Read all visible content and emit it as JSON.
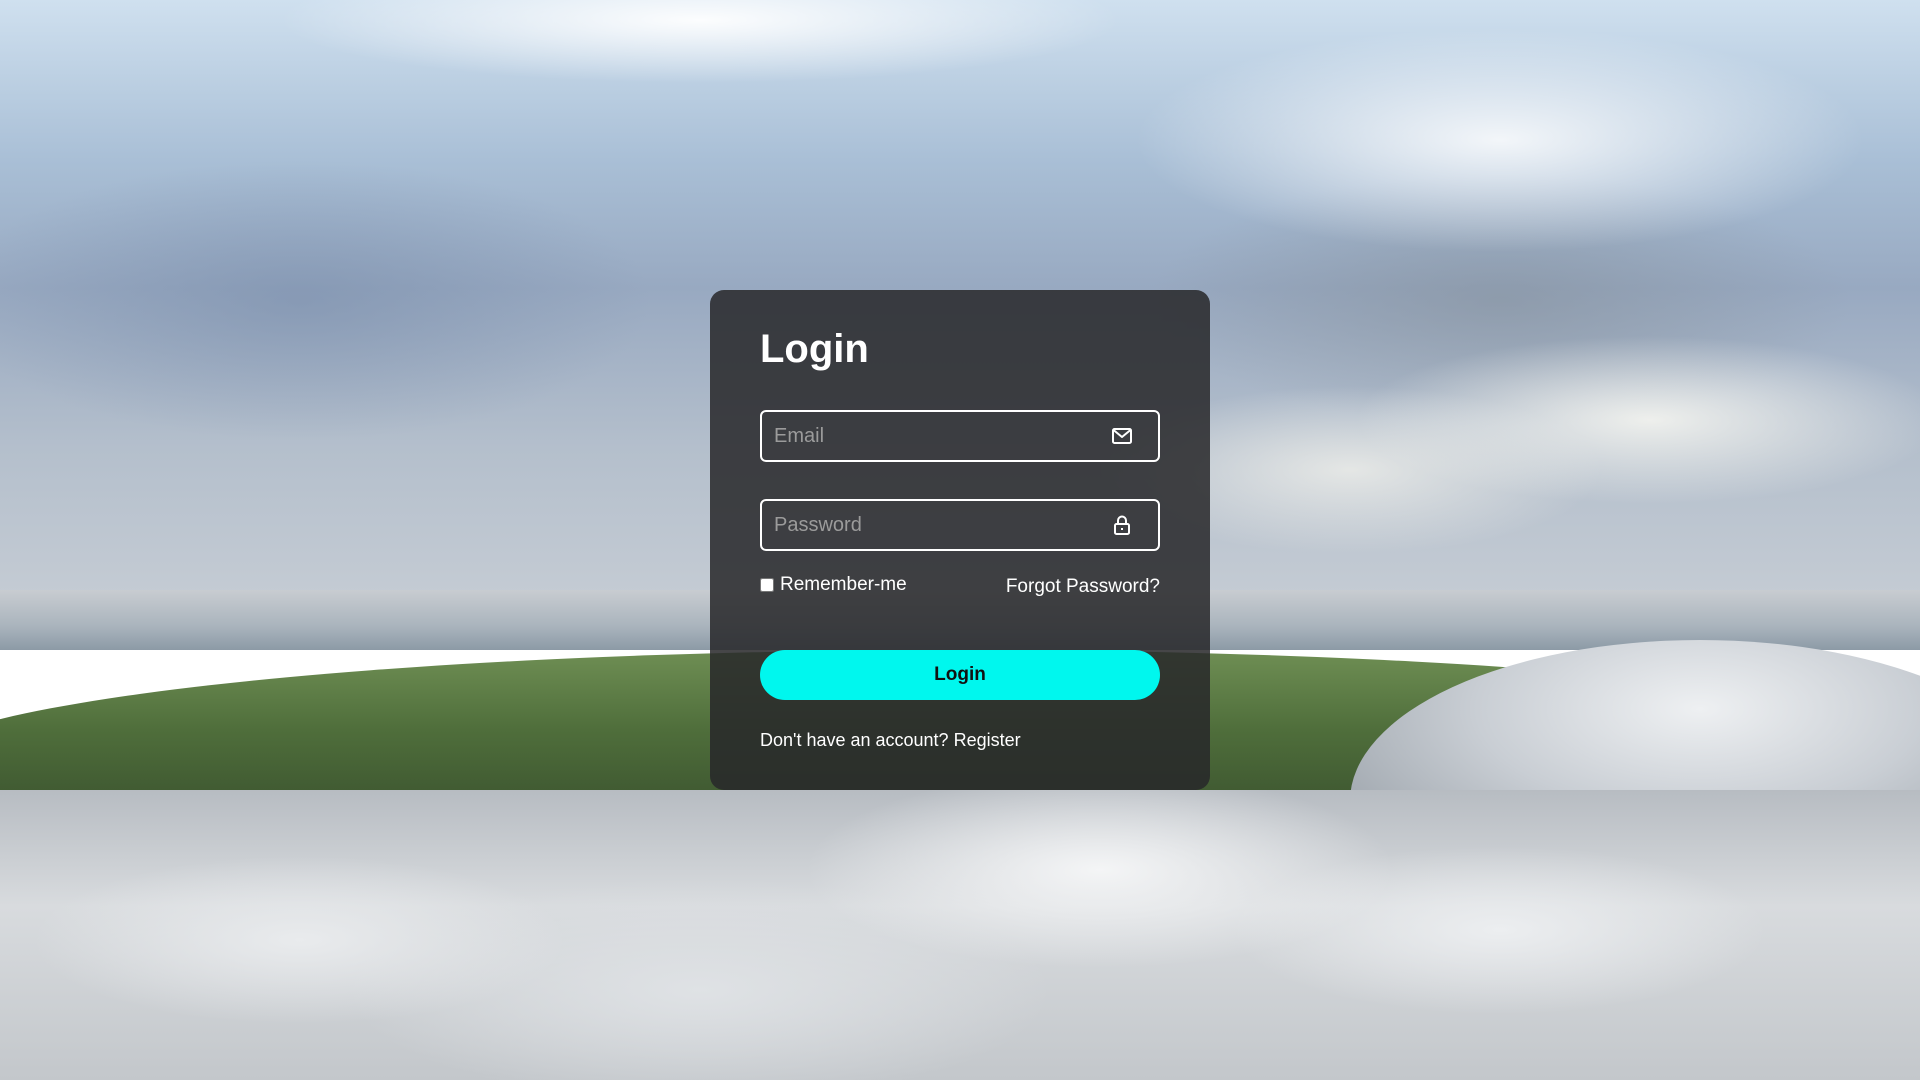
{
  "login": {
    "title": "Login",
    "email": {
      "placeholder": "Email",
      "value": "",
      "icon": "mail-icon"
    },
    "password": {
      "placeholder": "Password",
      "value": "",
      "icon": "lock-icon"
    },
    "remember_label": "Remember-me",
    "remember_checked": false,
    "forgot_label": "Forgot Password?",
    "submit_label": "Login",
    "register_prompt": "Don't have an account?",
    "register_link": "Register"
  },
  "colors": {
    "accent": "#00f7ee",
    "card_bg": "rgba(40,40,42,0.86)",
    "text": "#ffffff"
  }
}
